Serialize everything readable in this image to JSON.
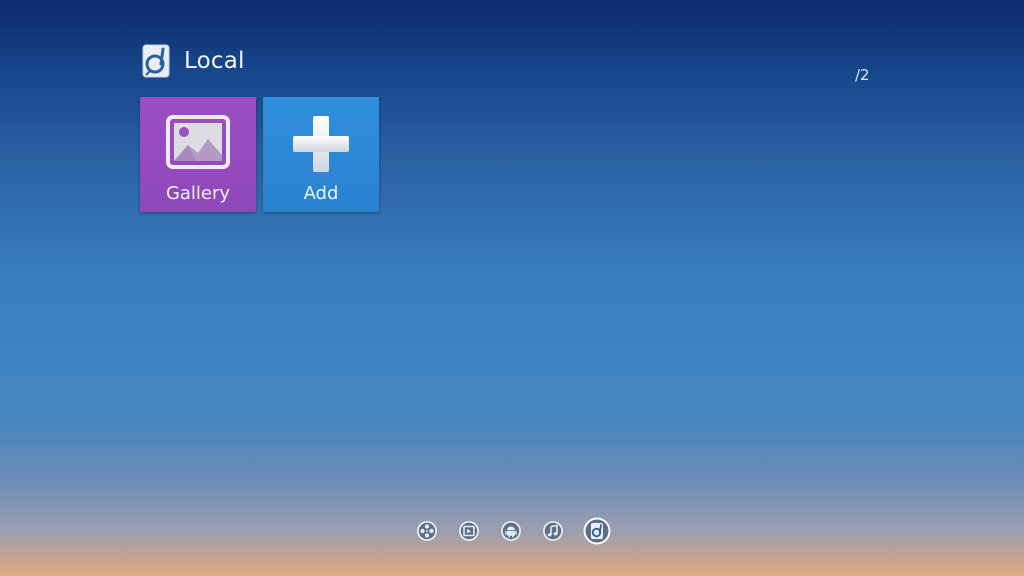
{
  "section": {
    "title": "Local",
    "icon": "local-storage-icon"
  },
  "page_indicator": "/2",
  "tiles": [
    {
      "label": "Gallery",
      "icon": "gallery-image-icon",
      "color": "#9a4fc2"
    },
    {
      "label": "Add",
      "icon": "plus-icon",
      "color": "#2f8fdc"
    }
  ],
  "dock": {
    "items": [
      {
        "icon": "film-reel-icon",
        "active": false
      },
      {
        "icon": "video-icon",
        "active": false
      },
      {
        "icon": "android-icon",
        "active": false
      },
      {
        "icon": "music-note-icon",
        "active": false
      },
      {
        "icon": "local-storage-icon",
        "active": true
      }
    ]
  }
}
